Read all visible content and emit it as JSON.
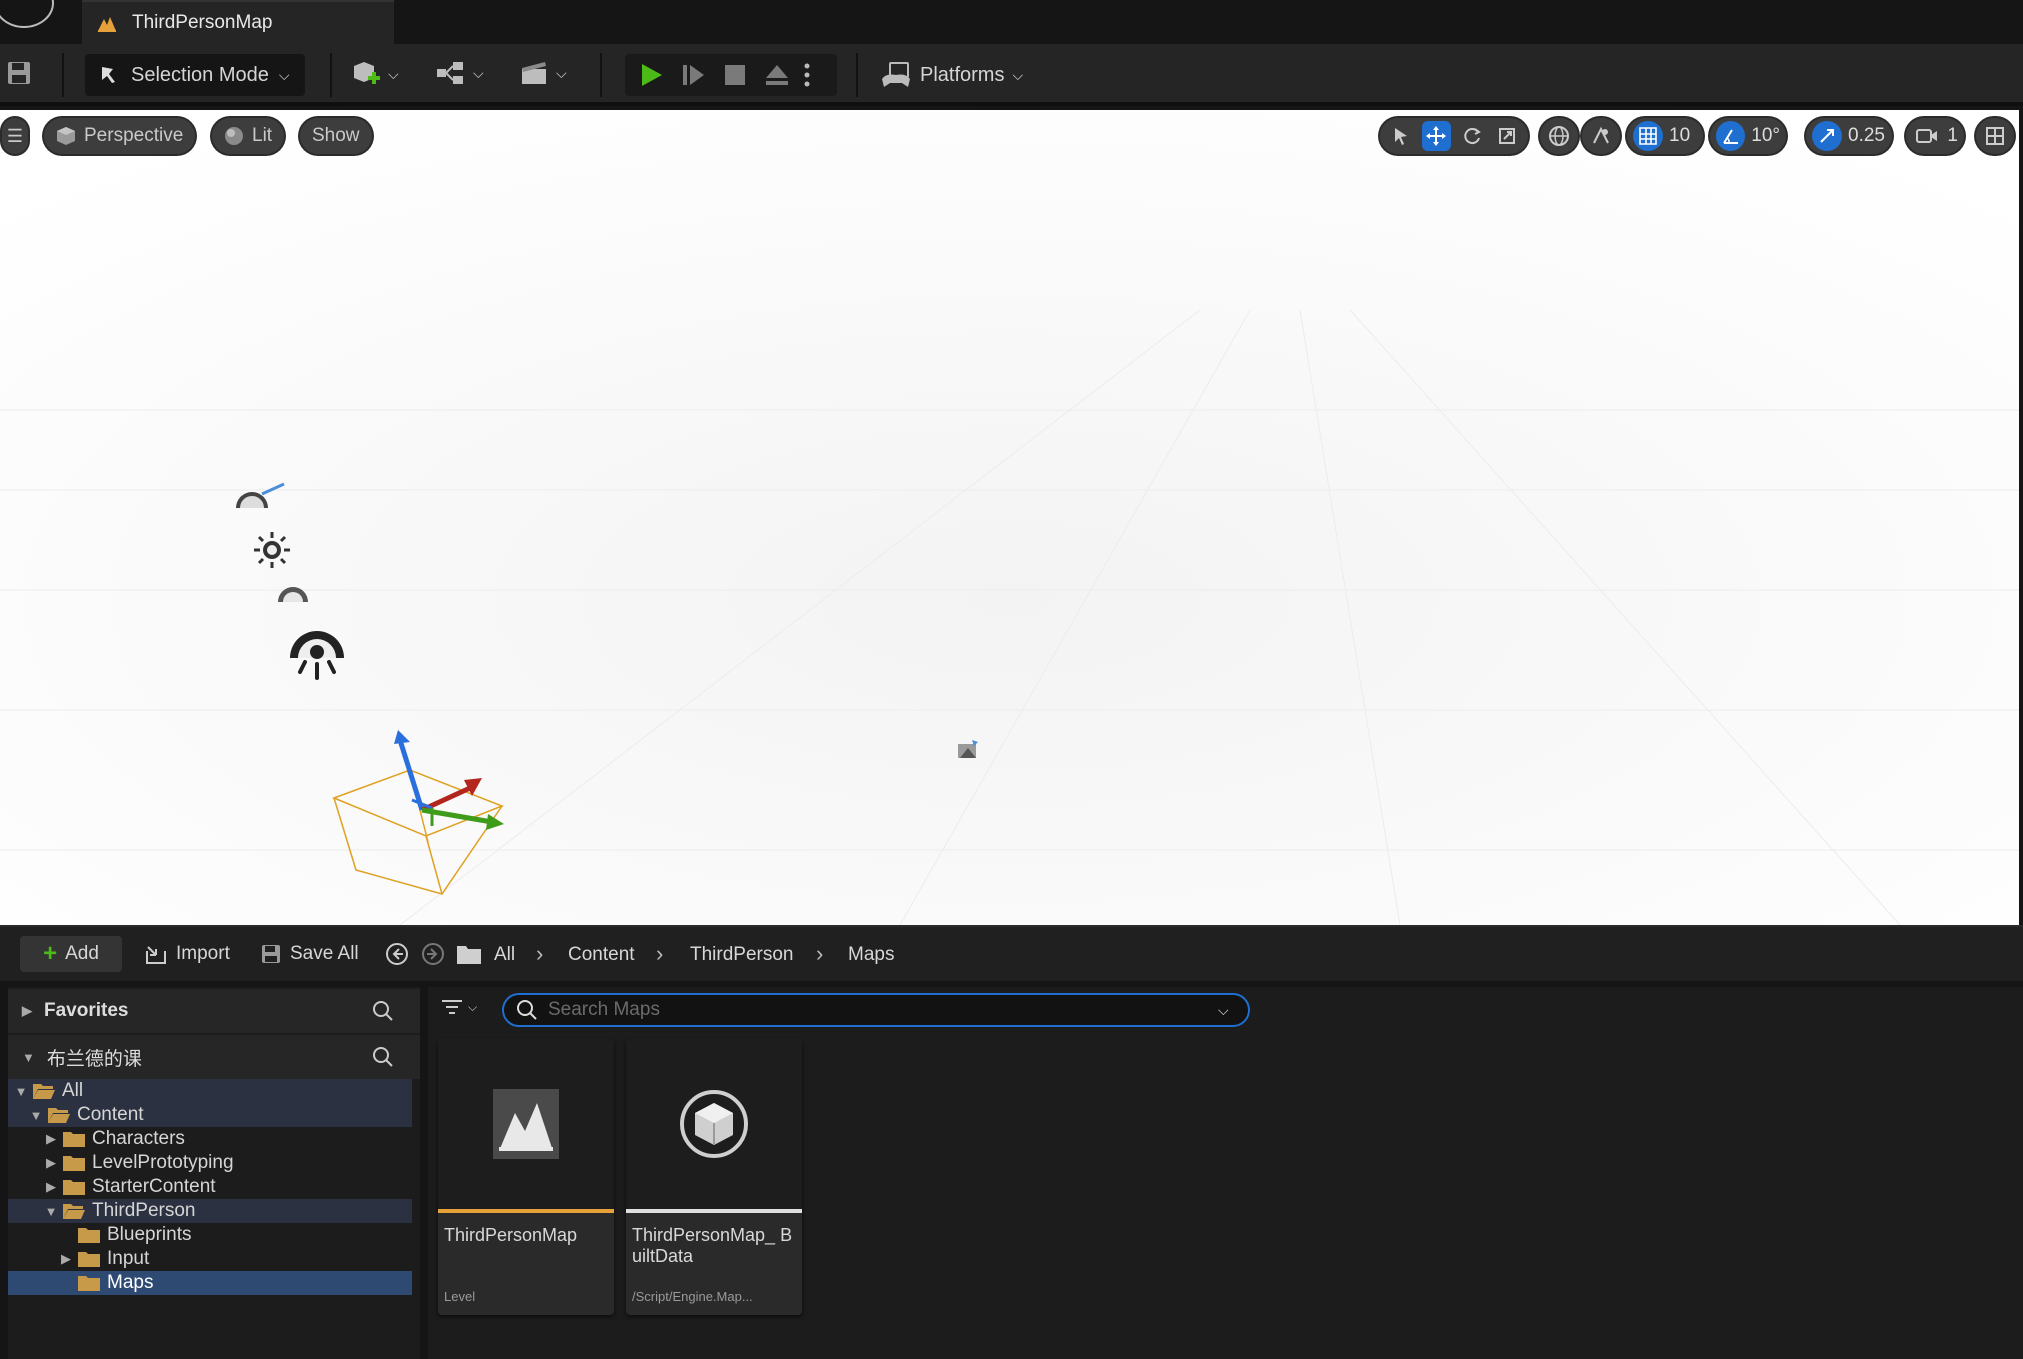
{
  "window": {
    "tab_title": "ThirdPersonMap"
  },
  "toolbar": {
    "selection_mode": "Selection Mode",
    "platforms": "Platforms"
  },
  "viewport": {
    "perspective": "Perspective",
    "lit": "Lit",
    "show": "Show",
    "grid_snap": "10",
    "rotation_snap": "10°",
    "scale_snap": "0.25",
    "camera_speed": "1"
  },
  "content_browser": {
    "add": "Add",
    "import": "Import",
    "save_all": "Save All",
    "breadcrumb": [
      "All",
      "Content",
      "ThirdPerson",
      "Maps"
    ],
    "favorites": "Favorites",
    "project": "布兰德的课",
    "search_placeholder": "Search Maps",
    "tree": [
      {
        "label": "All",
        "indent": 0,
        "caret": "down",
        "open": true
      },
      {
        "label": "Content",
        "indent": 1,
        "caret": "down",
        "open": true
      },
      {
        "label": "Characters",
        "indent": 2,
        "caret": "right",
        "open": false
      },
      {
        "label": "LevelPrototyping",
        "indent": 2,
        "caret": "right",
        "open": false
      },
      {
        "label": "StarterContent",
        "indent": 2,
        "caret": "right",
        "open": false
      },
      {
        "label": "ThirdPerson",
        "indent": 2,
        "caret": "down",
        "open": true
      },
      {
        "label": "Blueprints",
        "indent": 3,
        "caret": "none",
        "open": false
      },
      {
        "label": "Input",
        "indent": 3,
        "caret": "right",
        "open": false
      },
      {
        "label": "Maps",
        "indent": 3,
        "caret": "none",
        "open": false
      }
    ],
    "assets": [
      {
        "name": "ThirdPersonMap",
        "type": "Level",
        "bar_color": "#e6a13a"
      },
      {
        "name": "ThirdPersonMap_ BuiltData",
        "type": "/Script/Engine.Map...",
        "bar_color": "#e0e0e0"
      }
    ]
  },
  "colors": {
    "accent_blue": "#1f6fd1",
    "play_green": "#4cbb17",
    "selected_row": "#2e4a73"
  }
}
